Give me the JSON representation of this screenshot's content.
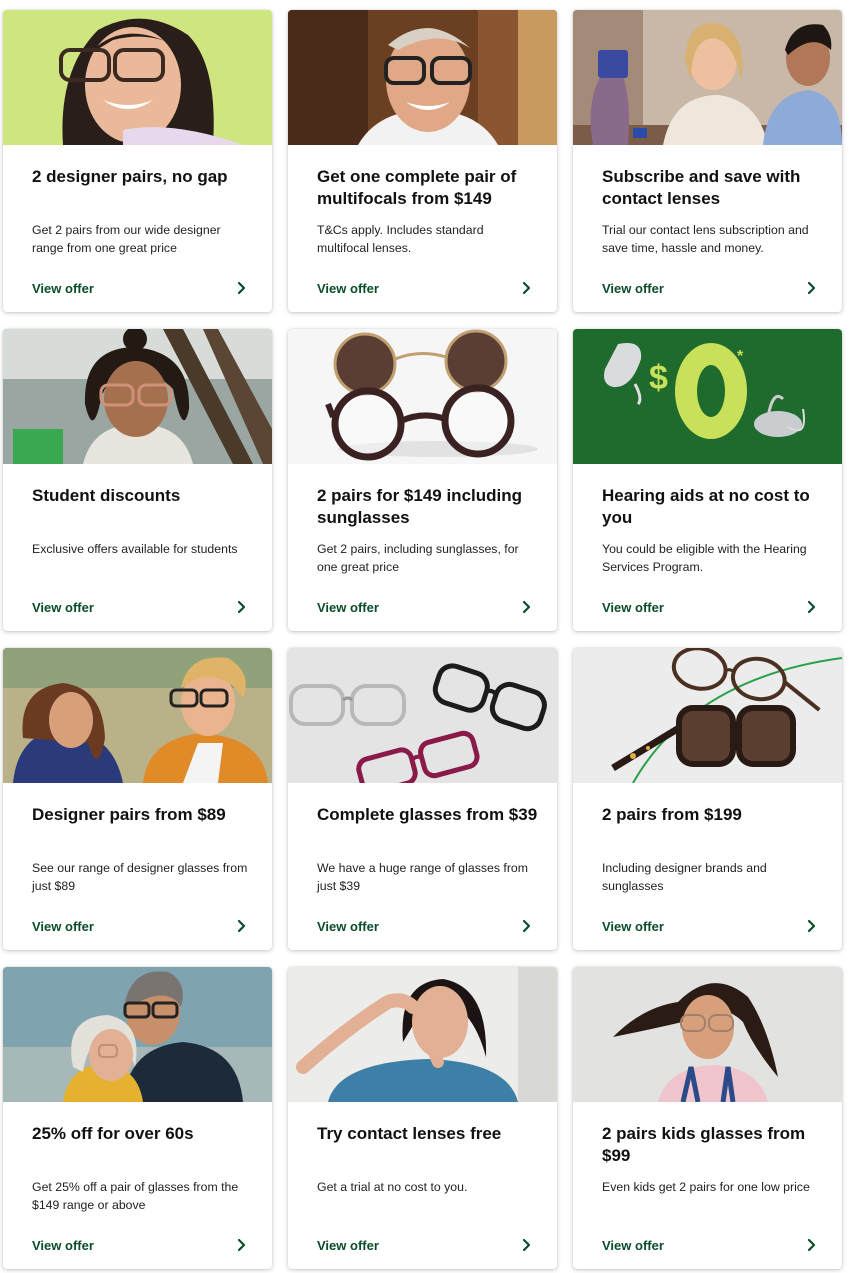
{
  "offers": [
    {
      "title": "2 designer pairs, no gap",
      "desc": "Get 2 pairs from our wide designer range from one great price",
      "cta": "View offer"
    },
    {
      "title": "Get one complete pair of multifocals from $149",
      "desc": "T&Cs apply. Includes standard multifocal lenses.",
      "cta": "View offer"
    },
    {
      "title": "Subscribe and save with contact lenses",
      "desc": "Trial our contact lens subscription and save time, hassle and money.",
      "cta": "View offer"
    },
    {
      "title": "Student discounts",
      "desc": "Exclusive offers available for students",
      "cta": "View offer"
    },
    {
      "title": "2 pairs for $149 including sunglasses",
      "desc": "Get 2 pairs, including sunglasses, for one great price",
      "cta": "View offer"
    },
    {
      "title": "Hearing aids at no cost to you",
      "desc": "You could be eligible with the Hearing Services Program.",
      "cta": "View offer",
      "badge_text": "$0",
      "badge_mark": "*"
    },
    {
      "title": "Designer pairs from $89",
      "desc": "See our range of designer glasses from just $89",
      "cta": "View offer"
    },
    {
      "title": "Complete glasses from $39",
      "desc": "We have a huge range of glasses from just $39",
      "cta": "View offer"
    },
    {
      "title": "2 pairs from $199",
      "desc": "Including designer brands and sunglasses",
      "cta": "View offer"
    },
    {
      "title": "25% off for over 60s",
      "desc": "Get 25% off a pair of glasses from the $149 range or above",
      "cta": "View offer"
    },
    {
      "title": "Try contact lenses free",
      "desc": "Get a trial at no cost to you.",
      "cta": "View offer"
    },
    {
      "title": "2 pairs kids glasses from $99",
      "desc": "Even kids get 2 pairs for one low price",
      "cta": "View offer"
    }
  ],
  "colors": {
    "cta_green": "#0b4d2a",
    "brand_lime": "#c8e05a",
    "brand_dark_green": "#1f6b2e"
  },
  "icons": {
    "cta": "chevron-right-icon"
  }
}
